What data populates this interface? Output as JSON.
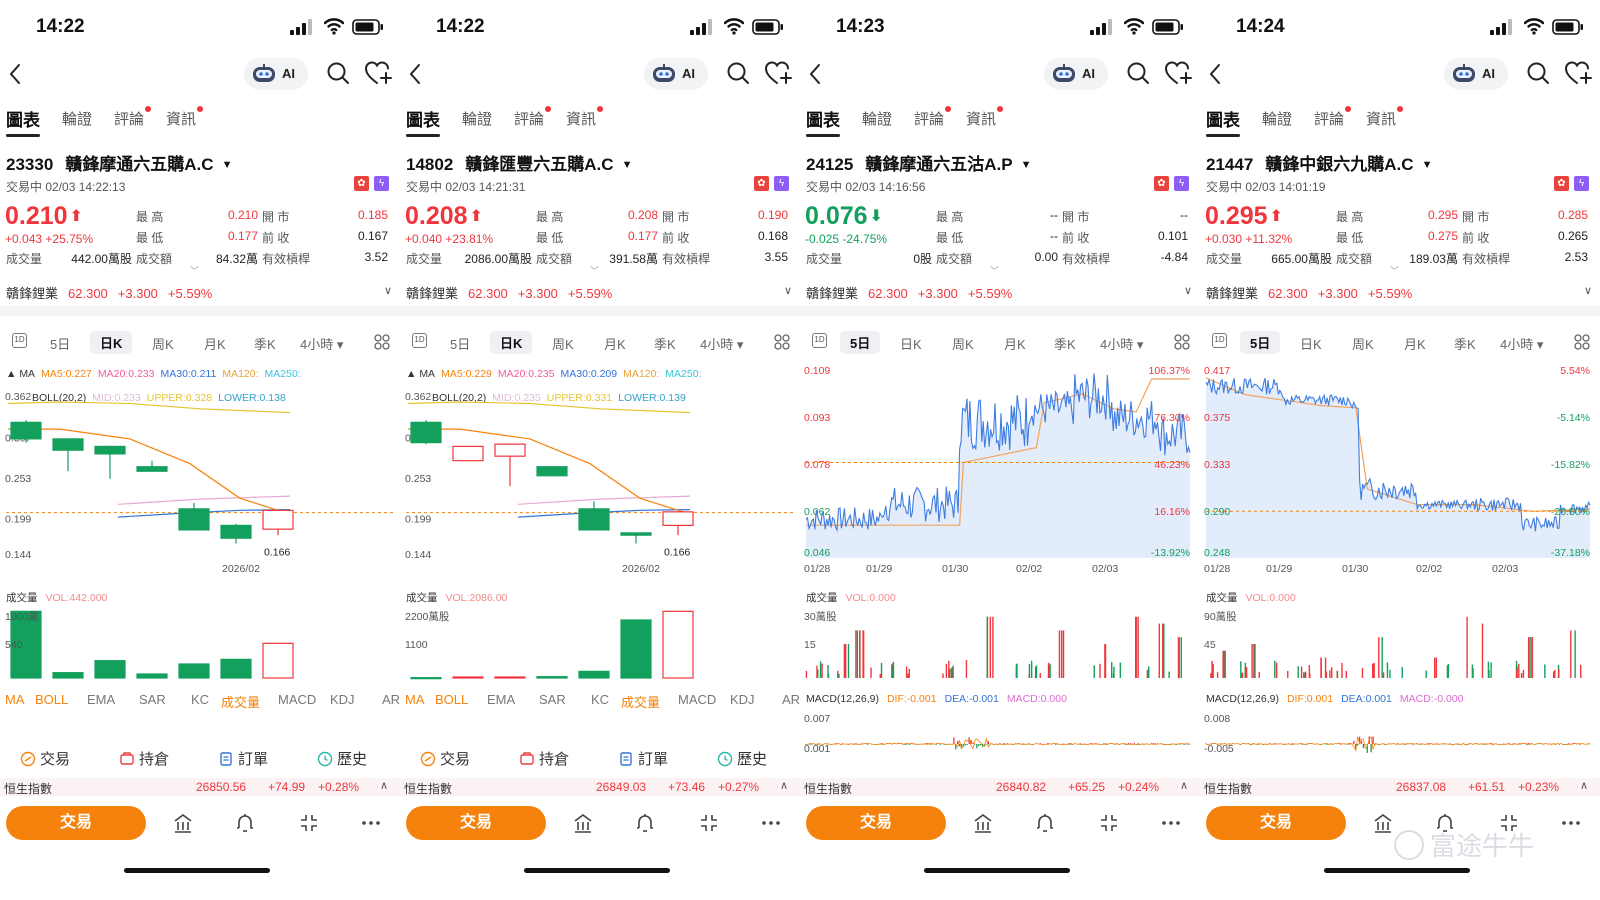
{
  "colors": {
    "up": "#f0363c",
    "down": "#12a05c",
    "accent": "#f5820c",
    "ma5": "#f5820c",
    "ma20": "#f05ba0",
    "ma30": "#3273d9",
    "ma120": "#e8a13c",
    "ma250": "#3ac3d9",
    "upper": "#e6c430",
    "lower": "#3aa0c8"
  },
  "watermark": "富途牛牛",
  "panels": [
    {
      "status": {
        "time": "14:22"
      },
      "nav": {
        "ai_label": "AI"
      },
      "tabs": [
        {
          "label": "圖表"
        },
        {
          "label": "輪證"
        },
        {
          "label": "評論"
        },
        {
          "label": "資訊"
        }
      ],
      "code": "23330",
      "name": "贛鋒摩通六五購A.C",
      "trade_status": "交易中 02/03 14:22:13",
      "price": "0.210",
      "direction": "up",
      "arrow": "⬆",
      "change": "+0.043",
      "change_pct": "+25.75%",
      "stats": {
        "high_label": "最 高",
        "high": "0.210",
        "open_label": "開 市",
        "open": "0.185",
        "low_label": "最 低",
        "low": "0.177",
        "prev_label": "前 收",
        "prev": "0.167",
        "vol_label": "成交量",
        "vol": "442.00萬股",
        "amt_label": "成交額",
        "amt": "84.32萬",
        "lev_label": "有效槓桿",
        "lev": "3.52"
      },
      "underlying": {
        "name": "贛鋒鋰業",
        "price": "62.300",
        "chg": "+3.300",
        "pct": "+5.59%"
      },
      "ktabs": [
        {
          "label": "5日"
        },
        {
          "label": "日K",
          "active": true
        },
        {
          "label": "周K"
        },
        {
          "label": "月K"
        },
        {
          "label": "季K"
        },
        {
          "label": "4小時 ▾"
        }
      ],
      "ktab_icon": "1D",
      "chart_mode": "candle",
      "ma": {
        "label": "MA",
        "ma5": "MA5:0.227",
        "ma20": "MA20:0.233",
        "ma30": "MA30:0.211",
        "ma120": "MA120:",
        "ma250": "MA250:"
      },
      "boll": {
        "label": "BOLL(20,2)",
        "mid": "MID:0.233",
        "upper": "UPPER:0.328",
        "lower": "LOWER:0.138"
      },
      "axis": {
        "top": "0.362",
        "mid": "0.253",
        "low1": "0.199",
        "bottom": "0.144",
        "pl": "0.307",
        "min_label": "0.166",
        "xlabel": "2026/02"
      },
      "vol_header": {
        "label": "成交量",
        "value": "VOL:442.000"
      },
      "vol_axis": {
        "top": "1000萬",
        "mid": "540"
      },
      "indicators": [
        {
          "label": "MA",
          "on": true
        },
        {
          "label": "BOLL",
          "on": true
        },
        {
          "label": "EMA"
        },
        {
          "label": "SAR"
        },
        {
          "label": "KC"
        },
        {
          "label": "成交量",
          "on": true
        },
        {
          "label": "MACD"
        },
        {
          "label": "KDJ"
        },
        {
          "label": "ARBR"
        }
      ],
      "actions": [
        {
          "label": "交易"
        },
        {
          "label": "持倉"
        },
        {
          "label": "訂單"
        },
        {
          "label": "歷史"
        }
      ],
      "hsi": {
        "name": "恒生指數",
        "value": "26850.56",
        "chg": "+74.99",
        "pct": "+0.28%"
      },
      "trade_button": "交易"
    },
    {
      "status": {
        "time": "14:22"
      },
      "nav": {
        "ai_label": "AI"
      },
      "tabs": [
        {
          "label": "圖表"
        },
        {
          "label": "輪證"
        },
        {
          "label": "評論"
        },
        {
          "label": "資訊"
        }
      ],
      "code": "14802",
      "name": "贛鋒匯豐六五購A.C",
      "trade_status": "交易中 02/03 14:21:31",
      "price": "0.208",
      "direction": "up",
      "arrow": "⬆",
      "change": "+0.040",
      "change_pct": "+23.81%",
      "stats": {
        "high_label": "最 高",
        "high": "0.208",
        "open_label": "開 市",
        "open": "0.190",
        "low_label": "最 低",
        "low": "0.177",
        "prev_label": "前 收",
        "prev": "0.168",
        "vol_label": "成交量",
        "vol": "2086.00萬股",
        "amt_label": "成交額",
        "amt": "391.58萬",
        "lev_label": "有效槓桿",
        "lev": "3.55"
      },
      "underlying": {
        "name": "贛鋒鋰業",
        "price": "62.300",
        "chg": "+3.300",
        "pct": "+5.59%"
      },
      "ktabs": [
        {
          "label": "5日"
        },
        {
          "label": "日K",
          "active": true
        },
        {
          "label": "周K"
        },
        {
          "label": "月K"
        },
        {
          "label": "季K"
        },
        {
          "label": "4小時 ▾"
        }
      ],
      "ktab_icon": "1D",
      "chart_mode": "candle",
      "ma": {
        "label": "MA",
        "ma5": "MA5:0.229",
        "ma20": "MA20:0.235",
        "ma30": "MA30:0.209",
        "ma120": "MA120:",
        "ma250": "MA250:"
      },
      "boll": {
        "label": "BOLL(20,2)",
        "mid": "MID:0.235",
        "upper": "UPPER:0.331",
        "lower": "LOWER:0.139"
      },
      "axis": {
        "top": "0.362",
        "mid": "0.253",
        "low1": "0.199",
        "bottom": "0.144",
        "pl": "0.307",
        "min_label": "0.166",
        "xlabel": "2026/02"
      },
      "vol_header": {
        "label": "成交量",
        "value": "VOL:2086.00"
      },
      "vol_axis": {
        "top": "2200萬股",
        "mid": "1100"
      },
      "indicators": [
        {
          "label": "MA",
          "on": true
        },
        {
          "label": "BOLL",
          "on": true
        },
        {
          "label": "EMA"
        },
        {
          "label": "SAR"
        },
        {
          "label": "KC"
        },
        {
          "label": "成交量",
          "on": true
        },
        {
          "label": "MACD"
        },
        {
          "label": "KDJ"
        },
        {
          "label": "ARBR"
        }
      ],
      "actions": [
        {
          "label": "交易"
        },
        {
          "label": "持倉"
        },
        {
          "label": "訂單"
        },
        {
          "label": "歷史"
        }
      ],
      "hsi": {
        "name": "恒生指數",
        "value": "26849.03",
        "chg": "+73.46",
        "pct": "+0.27%"
      },
      "trade_button": "交易"
    },
    {
      "status": {
        "time": "14:23"
      },
      "nav": {
        "ai_label": "AI"
      },
      "tabs": [
        {
          "label": "圖表"
        },
        {
          "label": "輪證"
        },
        {
          "label": "評論"
        },
        {
          "label": "資訊"
        }
      ],
      "code": "24125",
      "name": "贛鋒摩通六五沽A.P",
      "trade_status": "交易中 02/03 14:16:56",
      "price": "0.076",
      "direction": "down",
      "arrow": "⬇",
      "change": "-0.025",
      "change_pct": "-24.75%",
      "stats": {
        "high_label": "最 高",
        "high": "--",
        "open_label": "開 市",
        "open": "--",
        "low_label": "最 低",
        "low": "--",
        "prev_label": "前 收",
        "prev": "0.101",
        "vol_label": "成交量",
        "vol": "0股",
        "amt_label": "成交額",
        "amt": "0.00",
        "lev_label": "有效槓桿",
        "lev": "-4.84"
      },
      "underlying": {
        "name": "贛鋒鋰業",
        "price": "62.300",
        "chg": "+3.300",
        "pct": "+5.59%"
      },
      "ktabs": [
        {
          "label": "5日",
          "active": true
        },
        {
          "label": "日K"
        },
        {
          "label": "周K"
        },
        {
          "label": "月K"
        },
        {
          "label": "季K"
        },
        {
          "label": "4小時 ▾"
        }
      ],
      "ktab_icon": "1D",
      "chart_mode": "line",
      "axis": {
        "top": "0.109",
        "l2": "0.093",
        "l3": "0.078",
        "l4": "0.062",
        "bottom": "0.046",
        "r1": "106.37%",
        "r2": "76.30%",
        "r3": "46.23%",
        "r4": "16.16%",
        "r5": "-13.92%",
        "dates": [
          "01/28",
          "01/29",
          "01/30",
          "02/02",
          "02/03"
        ]
      },
      "vol_header": {
        "label": "成交量",
        "value": "VOL:0.000"
      },
      "vol_axis": {
        "top": "30萬股",
        "mid": "15"
      },
      "macd": {
        "label": "MACD(12,26,9)",
        "dif": "DIF:-0.001",
        "dea": "DEA:-0.001",
        "macd": "MACD:0.000",
        "top": "0.007",
        "mid": "0.001"
      },
      "actions": [],
      "hsi": {
        "name": "恒生指數",
        "value": "26840.82",
        "chg": "+65.25",
        "pct": "+0.24%"
      },
      "trade_button": "交易"
    },
    {
      "status": {
        "time": "14:24"
      },
      "nav": {
        "ai_label": "AI"
      },
      "tabs": [
        {
          "label": "圖表"
        },
        {
          "label": "輪證"
        },
        {
          "label": "評論"
        },
        {
          "label": "資訊"
        }
      ],
      "code": "21447",
      "name": "贛鋒中銀六九購A.C",
      "trade_status": "交易中 02/03 14:01:19",
      "price": "0.295",
      "direction": "up",
      "arrow": "⬆",
      "change": "+0.030",
      "change_pct": "+11.32%",
      "stats": {
        "high_label": "最 高",
        "high": "0.295",
        "open_label": "開 市",
        "open": "0.285",
        "low_label": "最 低",
        "low": "0.275",
        "prev_label": "前 收",
        "prev": "0.265",
        "vol_label": "成交量",
        "vol": "665.00萬股",
        "amt_label": "成交額",
        "amt": "189.03萬",
        "lev_label": "有效槓桿",
        "lev": "2.53"
      },
      "underlying": {
        "name": "贛鋒鋰業",
        "price": "62.300",
        "chg": "+3.300",
        "pct": "+5.59%"
      },
      "ktabs": [
        {
          "label": "5日",
          "active": true
        },
        {
          "label": "日K"
        },
        {
          "label": "周K"
        },
        {
          "label": "月K"
        },
        {
          "label": "季K"
        },
        {
          "label": "4小時 ▾"
        }
      ],
      "ktab_icon": "1D",
      "chart_mode": "line",
      "axis": {
        "top": "0.417",
        "l2": "0.375",
        "l3": "0.333",
        "l4": "0.290",
        "bottom": "0.248",
        "r1": "5.54%",
        "r2": "-5.14%",
        "r3": "-15.82%",
        "r4": "-26.50%",
        "r5": "-37.18%",
        "dates": [
          "01/28",
          "01/29",
          "01/30",
          "02/02",
          "02/03"
        ]
      },
      "vol_header": {
        "label": "成交量",
        "value": "VOL:0.000"
      },
      "vol_axis": {
        "top": "90萬股",
        "mid": "45"
      },
      "macd": {
        "label": "MACD(12,26,9)",
        "dif": "DIF:0.001",
        "dea": "DEA:0.001",
        "macd": "MACD:-0.000",
        "top": "0.008",
        "mid": "-0.005"
      },
      "actions": [],
      "hsi": {
        "name": "恒生指數",
        "value": "26837.08",
        "chg": "+61.51",
        "pct": "+0.23%"
      },
      "trade_button": "交易"
    }
  ]
}
